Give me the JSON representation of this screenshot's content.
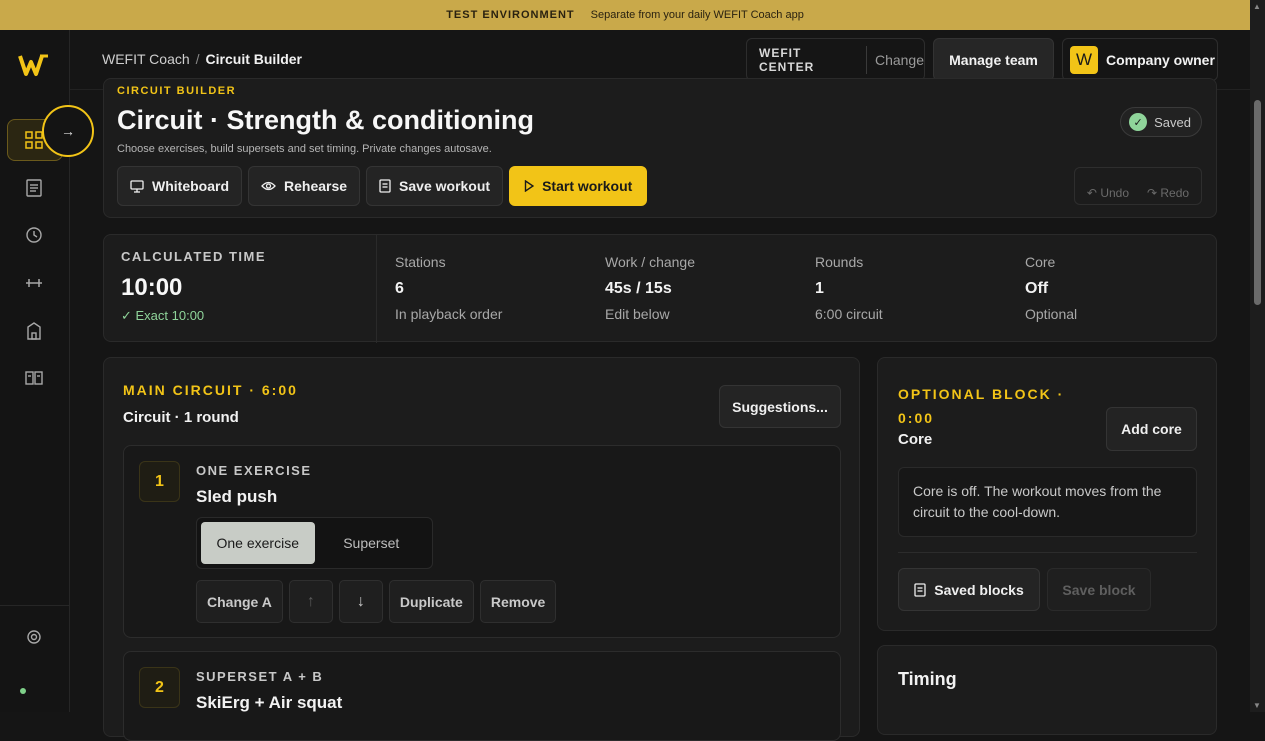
{
  "banner": {
    "tag": "TEST ENVIRONMENT",
    "text": "Separate from your daily WEFIT Coach app"
  },
  "breadcrumb": {
    "root": "WEFIT Coach",
    "sep": "/",
    "current": "Circuit Builder"
  },
  "center": {
    "name": "WEFIT CENTER",
    "change": "Change"
  },
  "manage_team": "Manage team",
  "owner": {
    "initial": "W",
    "label": "Company owner"
  },
  "hero": {
    "eyebrow": "CIRCUIT BUILDER",
    "title": "Circuit · Strength & conditioning",
    "subtitle": "Choose exercises, build supersets and set timing. Private changes autosave.",
    "buttons": {
      "whiteboard": "Whiteboard",
      "rehearse": "Rehearse",
      "save": "Save workout",
      "start": "Start workout"
    },
    "saved": "Saved",
    "undo": "Undo",
    "redo": "Redo"
  },
  "stats": {
    "calc_label": "CALCULATED TIME",
    "calc_value": "10:00",
    "calc_ok": "✓ Exact 10:00",
    "items": [
      {
        "label": "Stations",
        "value": "6",
        "note": "In playback order"
      },
      {
        "label": "Work / change",
        "value": "45s / 15s",
        "note": "Edit below"
      },
      {
        "label": "Rounds",
        "value": "1",
        "note": "6:00 circuit"
      },
      {
        "label": "Core",
        "value": "Off",
        "note": "Optional"
      }
    ]
  },
  "main": {
    "title": "MAIN CIRCUIT · 6:00",
    "subtitle": "Circuit · 1 round",
    "suggestions": "Suggestions...",
    "exercises": [
      {
        "num": "1",
        "kind": "ONE EXERCISE",
        "name": "Sled push"
      },
      {
        "num": "2",
        "kind": "SUPERSET A + B",
        "name": "SkiErg + Air squat"
      }
    ],
    "seg": {
      "one": "One exercise",
      "superset": "Superset"
    },
    "actions": {
      "change": "Change A",
      "up": "↑",
      "down": "↓",
      "duplicate": "Duplicate",
      "remove": "Remove"
    }
  },
  "optional": {
    "title": "OPTIONAL BLOCK · 0:00",
    "subtitle": "Core",
    "add": "Add core",
    "note": "Core is off. The workout moves from the circuit to the cool-down.",
    "saved_blocks": "Saved blocks",
    "save_block": "Save block"
  },
  "timing": {
    "title": "Timing"
  },
  "colors": {
    "accent": "#f2c417",
    "banner": "#c9a94a",
    "ok": "#8fd49a",
    "bg": "#151515"
  }
}
